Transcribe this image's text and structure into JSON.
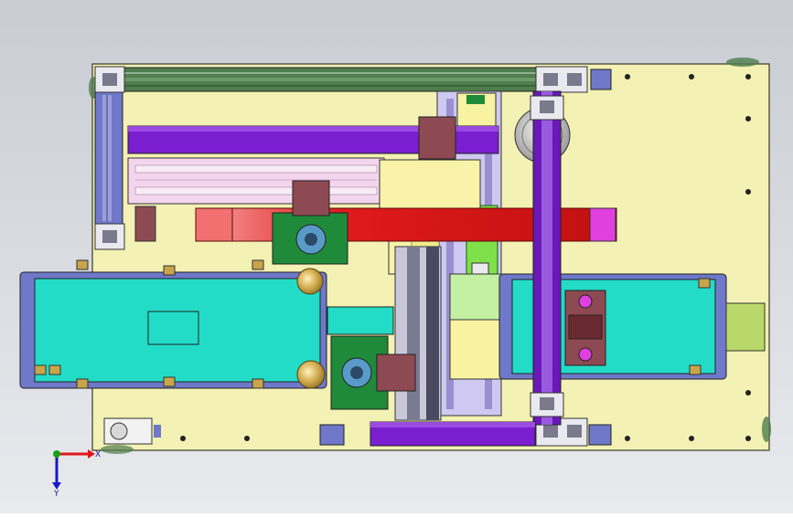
{
  "viewport": {
    "background_top": "#c9ccd3",
    "background_bottom": "#e9eaee"
  },
  "colors": {
    "base_plate": "#f3f1b3",
    "outline": "#3a3a2a",
    "frame_green": "#4f7d4d",
    "frame_purple": "#7a1fd0",
    "rail_purple": "#6a18b8",
    "pink": "#f3d6ee",
    "red": "#e01a1a",
    "cyan": "#22dcc7",
    "plate_blue": "#6f78c9",
    "bracket_brown": "#8e4a52",
    "block_green": "#1f8a3a",
    "bright_green": "#7fe04a",
    "lavender": "#cfc8f0",
    "gray_block": "#8a8a9a",
    "magenta": "#e040e0",
    "gold": "#c9a44a"
  },
  "triad": {
    "x_label": "X",
    "y_label": "Y",
    "x_color": "#e01818",
    "y_color": "#1818c8",
    "z_color": "#18a018"
  }
}
